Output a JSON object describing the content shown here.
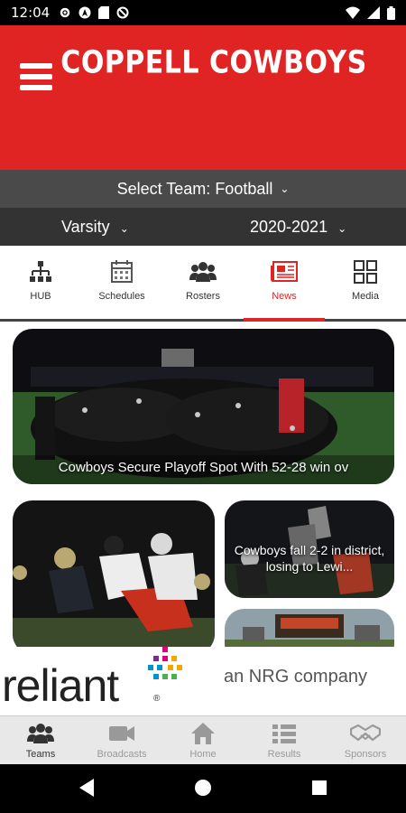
{
  "status_bar": {
    "time": "12:04"
  },
  "header": {
    "title": "COPPELL COWBOYS"
  },
  "team_selector": {
    "label": "Select Team:",
    "value": "Football"
  },
  "filters": {
    "level": "Varsity",
    "season": "2020-2021"
  },
  "section_tabs": [
    {
      "label": "HUB",
      "icon": "hub-icon"
    },
    {
      "label": "Schedules",
      "icon": "calendar-icon"
    },
    {
      "label": "Rosters",
      "icon": "people-icon"
    },
    {
      "label": "News",
      "icon": "newspaper-icon",
      "active": true
    },
    {
      "label": "Media",
      "icon": "grid-icon"
    }
  ],
  "news": [
    {
      "caption": "Cowboys Secure Playoff Spot With 52-28 win ov"
    },
    {
      "caption": ""
    },
    {
      "caption": "Cowboys fall 2-2 in district, losing to Lewi..."
    },
    {
      "caption": ""
    }
  ],
  "sponsor": {
    "name": "reliant",
    "tagline": "an NRG company",
    "reg": "®"
  },
  "bottom_nav": [
    {
      "label": "Teams",
      "icon": "people-icon",
      "active": true
    },
    {
      "label": "Broadcasts",
      "icon": "video-camera-icon"
    },
    {
      "label": "Home",
      "icon": "home-icon"
    },
    {
      "label": "Results",
      "icon": "list-icon"
    },
    {
      "label": "Sponsors",
      "icon": "handshake-icon"
    }
  ],
  "colors": {
    "brand_red": "#e02424",
    "dark_bar": "#333333",
    "mid_bar": "#4a4a4a"
  }
}
